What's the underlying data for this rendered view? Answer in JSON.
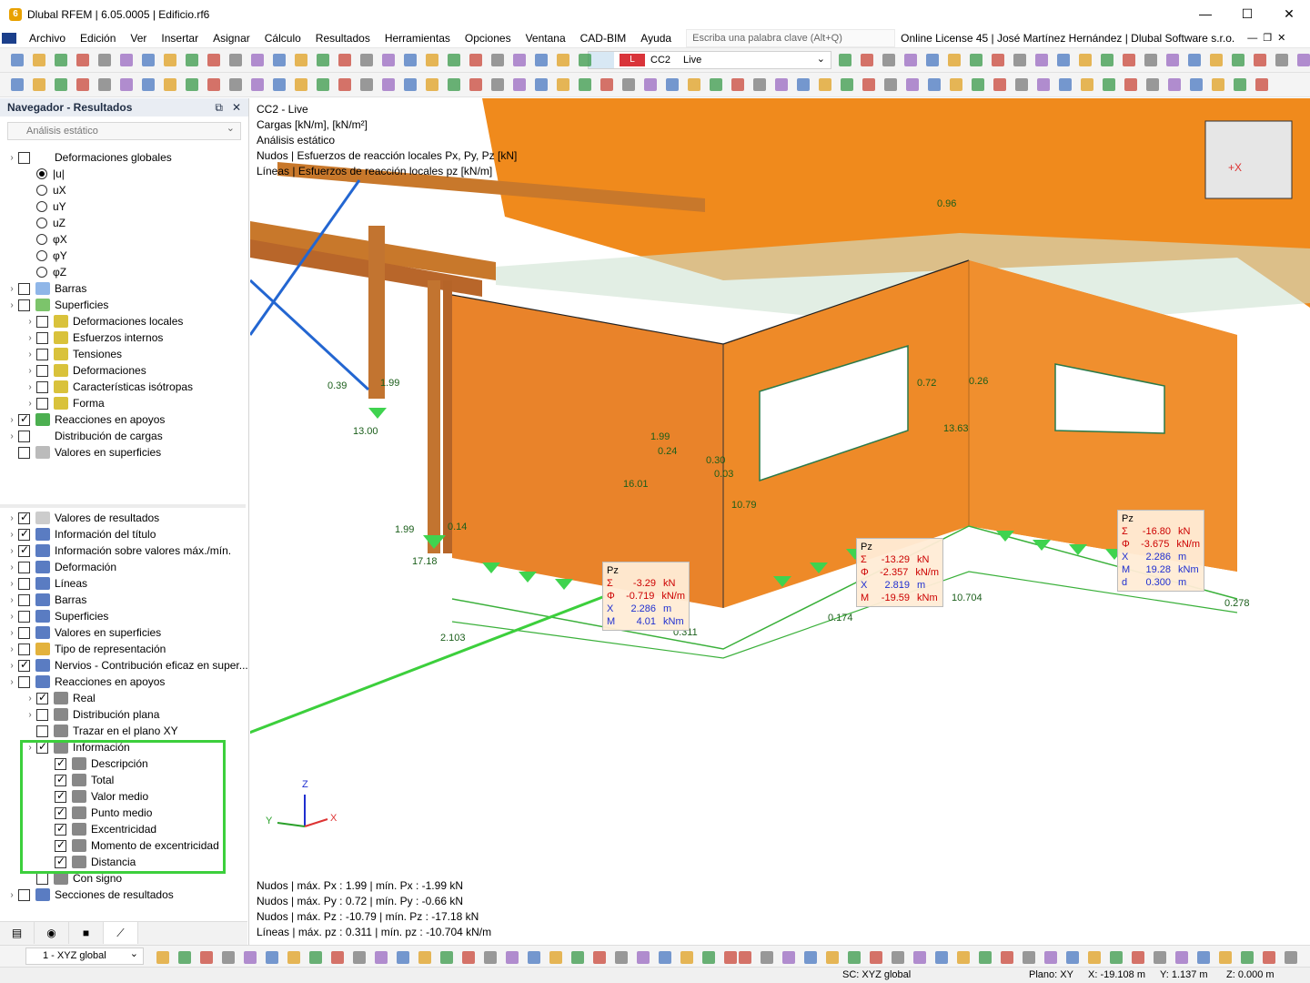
{
  "window": {
    "title": "Dlubal RFEM | 6.05.0005 | Edificio.rf6"
  },
  "menu": [
    "Archivo",
    "Edición",
    "Ver",
    "Insertar",
    "Asignar",
    "Cálculo",
    "Resultados",
    "Herramientas",
    "Opciones",
    "Ventana",
    "CAD-BIM",
    "Ayuda"
  ],
  "search": {
    "placeholder": "Escriba una palabra clave (Alt+Q)"
  },
  "license": "Online License 45 | José Martínez Hernández | Dlubal Software s.r.o.",
  "loadcase": {
    "tag": "L",
    "code": "CC2",
    "name": "Live"
  },
  "navigator": {
    "title": "Navegador - Resultados",
    "combo": "Análisis estático",
    "top_items": [
      "Deformaciones globales",
      "|u|",
      "uX",
      "uY",
      "uZ",
      "φX",
      "φY",
      "φZ",
      "Barras",
      "Superficies",
      "Deformaciones locales",
      "Esfuerzos internos",
      "Tensiones",
      "Deformaciones",
      "Características isótropas",
      "Forma",
      "Reacciones en apoyos",
      "Distribución de cargas",
      "Valores en superficies"
    ],
    "bottom_items": [
      "Valores de resultados",
      "Información del título",
      "Información sobre valores máx./mín.",
      "Deformación",
      "Líneas",
      "Barras",
      "Superficies",
      "Valores en superficies",
      "Tipo de representación",
      "Nervios - Contribución eficaz en super...",
      "Reacciones en apoyos",
      "Real",
      "Distribución plana",
      "Trazar en el plano XY",
      "Información",
      "Descripción",
      "Total",
      "Valor medio",
      "Punto medio",
      "Excentricidad",
      "Momento de excentricidad",
      "Distancia",
      "Con signo",
      "Secciones de resultados"
    ]
  },
  "viewport": {
    "header_lines": [
      "CC2 - Live",
      "Cargas [kN/m], [kN/m²]",
      "Análisis estático",
      "Nudos | Esfuerzos de reacción locales Px, Py, Pz [kN]",
      "Líneas | Esfuerzos de reacción locales pz [kN/m]"
    ],
    "footer_lines": [
      "Nudos | máx. Px : 1.99 | mín. Px : -1.99 kN",
      "Nudos | máx. Py : 0.72 | mín. Py : -0.66 kN",
      "Nudos | máx. Pz : -10.79 | mín. Pz : -17.18 kN",
      "Líneas | máx. pz : 0.311 | mín. pz : -10.704 kN/m"
    ],
    "labels": [
      "0.39",
      "1.99",
      "13.00",
      "1.99",
      "0.14",
      "17.18",
      "1.99",
      "0.24",
      "16.01",
      "0.30",
      "0.03",
      "10.79",
      "0.72",
      "0.26",
      "13.63",
      "2.103",
      "0.311",
      "0.174",
      "10.704",
      "0.278",
      "0.96"
    ],
    "infoboxes": [
      {
        "title": "Pz",
        "rows": [
          [
            "Σ",
            "-3.29",
            "kN"
          ],
          [
            "Φ",
            "-0.719",
            "kN/m"
          ],
          [
            "X",
            "2.286",
            "m"
          ],
          [
            "M",
            "4.01",
            "kNm"
          ]
        ]
      },
      {
        "title": "Pz",
        "rows": [
          [
            "Σ",
            "-13.29",
            "kN"
          ],
          [
            "Φ",
            "-2.357",
            "kN/m"
          ],
          [
            "X",
            "2.819",
            "m"
          ],
          [
            "M",
            "-19.59",
            "kNm"
          ]
        ]
      },
      {
        "title": "Pz",
        "rows": [
          [
            "Σ",
            "-16.80",
            "kN"
          ],
          [
            "Φ",
            "-3.675",
            "kN/m"
          ],
          [
            "X",
            "2.286",
            "m"
          ],
          [
            "M",
            "19.28",
            "kNm"
          ],
          [
            "d",
            "0.300",
            "m"
          ]
        ]
      }
    ],
    "axes": {
      "z": "Z",
      "y": "Y",
      "x": "X"
    }
  },
  "bottom_toolbar": {
    "view": "1 - XYZ global"
  },
  "status": {
    "sc": "SC: XYZ global",
    "plane": "Plano: XY",
    "x": "X: -19.108 m",
    "y": "Y: 1.137 m",
    "z": "Z: 0.000 m"
  }
}
